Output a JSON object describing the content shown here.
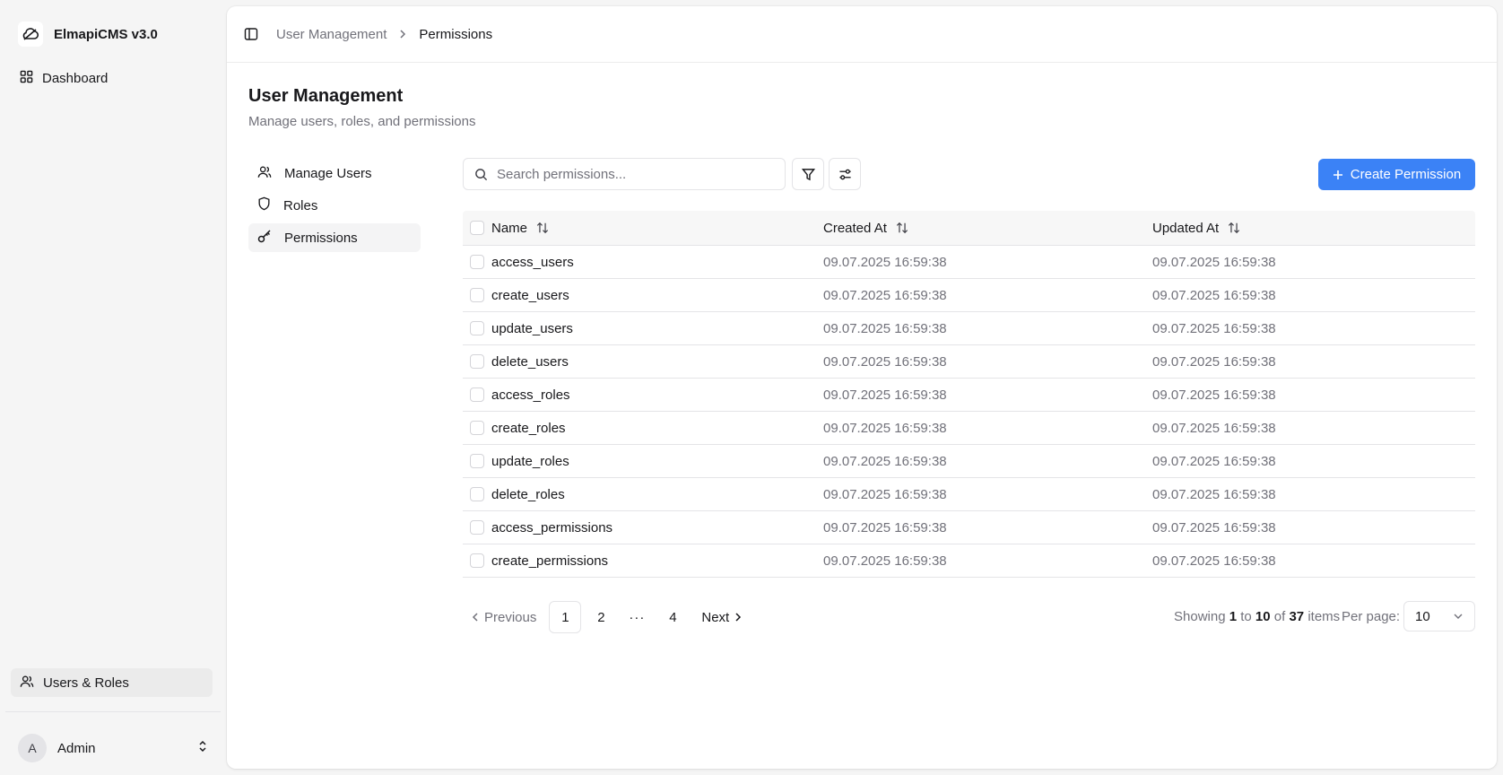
{
  "app": {
    "name": "ElmapiCMS v3.0"
  },
  "sidebar": {
    "dashboard_label": "Dashboard",
    "users_roles_label": "Users & Roles",
    "user": {
      "initial": "A",
      "name": "Admin"
    }
  },
  "breadcrumb": {
    "parent": "User Management",
    "current": "Permissions"
  },
  "page": {
    "title": "User Management",
    "subtitle": "Manage users, roles, and permissions"
  },
  "subnav": {
    "manage_users": "Manage Users",
    "roles": "Roles",
    "permissions": "Permissions"
  },
  "toolbar": {
    "search_placeholder": "Search permissions...",
    "create_label": "Create Permission"
  },
  "table": {
    "headers": {
      "name": "Name",
      "created": "Created At",
      "updated": "Updated At"
    },
    "rows": [
      {
        "name": "access_users",
        "created": "09.07.2025 16:59:38",
        "updated": "09.07.2025 16:59:38"
      },
      {
        "name": "create_users",
        "created": "09.07.2025 16:59:38",
        "updated": "09.07.2025 16:59:38"
      },
      {
        "name": "update_users",
        "created": "09.07.2025 16:59:38",
        "updated": "09.07.2025 16:59:38"
      },
      {
        "name": "delete_users",
        "created": "09.07.2025 16:59:38",
        "updated": "09.07.2025 16:59:38"
      },
      {
        "name": "access_roles",
        "created": "09.07.2025 16:59:38",
        "updated": "09.07.2025 16:59:38"
      },
      {
        "name": "create_roles",
        "created": "09.07.2025 16:59:38",
        "updated": "09.07.2025 16:59:38"
      },
      {
        "name": "update_roles",
        "created": "09.07.2025 16:59:38",
        "updated": "09.07.2025 16:59:38"
      },
      {
        "name": "delete_roles",
        "created": "09.07.2025 16:59:38",
        "updated": "09.07.2025 16:59:38"
      },
      {
        "name": "access_permissions",
        "created": "09.07.2025 16:59:38",
        "updated": "09.07.2025 16:59:38"
      },
      {
        "name": "create_permissions",
        "created": "09.07.2025 16:59:38",
        "updated": "09.07.2025 16:59:38"
      }
    ]
  },
  "pagination": {
    "previous": "Previous",
    "next": "Next",
    "pages": [
      "1",
      "2",
      "4"
    ],
    "ellipsis": "···",
    "showing_prefix": "Showing",
    "from": "1",
    "to_word": "to",
    "to": "10",
    "of_word": "of",
    "total": "37",
    "items_word": "items",
    "per_page_label": "Per page:",
    "per_page_value": "10"
  },
  "colors": {
    "accent": "#3b82f6",
    "muted_text": "#71717a"
  }
}
